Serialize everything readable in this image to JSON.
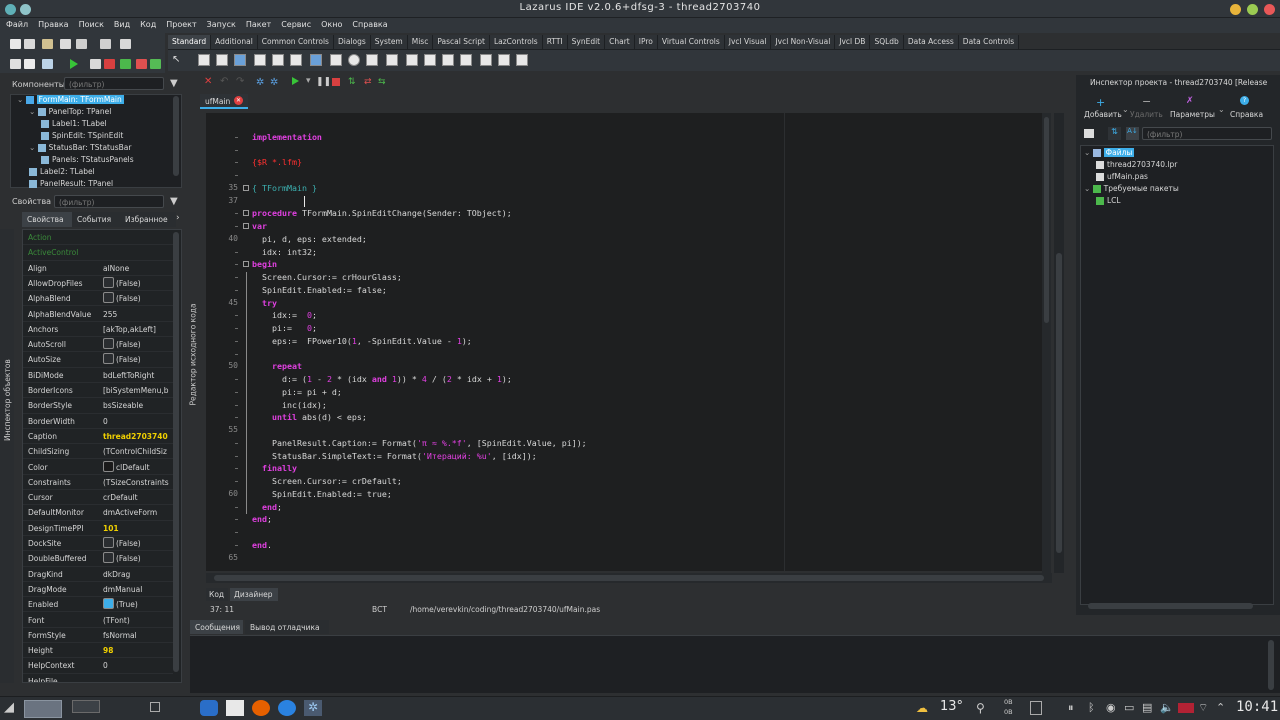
{
  "window": {
    "title": "Lazarus IDE v2.0.6+dfsg-3 - thread2703740"
  },
  "menu": [
    "Файл",
    "Правка",
    "Поиск",
    "Вид",
    "Код",
    "Проект",
    "Запуск",
    "Пакет",
    "Сервис",
    "Окно",
    "Справка"
  ],
  "palette_tabs": [
    "Standard",
    "Additional",
    "Common Controls",
    "Dialogs",
    "System",
    "Misc",
    "Pascal Script",
    "LazControls",
    "RTTI",
    "SynEdit",
    "Chart",
    "IPro",
    "Virtual Controls",
    "Jvcl Visual",
    "Jvcl Non-Visual",
    "Jvcl DB",
    "SQLdb",
    "Data Access",
    "Data Controls"
  ],
  "components": {
    "label": "Компоненты",
    "filter_placeholder": "(фильтр)",
    "tree": [
      {
        "text": "FormMain: TFormMain",
        "level": 0,
        "selected": true
      },
      {
        "text": "PanelTop: TPanel",
        "level": 1
      },
      {
        "text": "Label1: TLabel",
        "level": 2
      },
      {
        "text": "SpinEdit: TSpinEdit",
        "level": 2
      },
      {
        "text": "StatusBar: TStatusBar",
        "level": 1
      },
      {
        "text": "Panels: TStatusPanels",
        "level": 2
      },
      {
        "text": "Label2: TLabel",
        "level": 1
      },
      {
        "text": "PanelResult: TPanel",
        "level": 1
      }
    ]
  },
  "properties": {
    "label": "Свойства",
    "filter_placeholder": "(фильтр)",
    "tabs": [
      "Свойства",
      "События",
      "Избранное"
    ],
    "side_label": "Инспектор объектов",
    "rows": [
      {
        "name": "Action",
        "value": "",
        "type": "text"
      },
      {
        "name": "ActiveControl",
        "value": "",
        "type": "text"
      },
      {
        "name": "Align",
        "value": "alNone",
        "type": "text"
      },
      {
        "name": "AllowDropFiles",
        "value": "(False)",
        "type": "check"
      },
      {
        "name": "AlphaBlend",
        "value": "(False)",
        "type": "check"
      },
      {
        "name": "AlphaBlendValue",
        "value": "255",
        "type": "text"
      },
      {
        "name": "Anchors",
        "value": "[akTop,akLeft]",
        "type": "text",
        "expand": true
      },
      {
        "name": "AutoScroll",
        "value": "(False)",
        "type": "check"
      },
      {
        "name": "AutoSize",
        "value": "(False)",
        "type": "check"
      },
      {
        "name": "BiDiMode",
        "value": "bdLeftToRight",
        "type": "text"
      },
      {
        "name": "BorderIcons",
        "value": "[biSystemMenu,b",
        "type": "text",
        "expand": true
      },
      {
        "name": "BorderStyle",
        "value": "bsSizeable",
        "type": "text"
      },
      {
        "name": "BorderWidth",
        "value": "0",
        "type": "text"
      },
      {
        "name": "Caption",
        "value": "thread2703740",
        "type": "text",
        "bold": true
      },
      {
        "name": "ChildSizing",
        "value": "(TControlChildSiz",
        "type": "text",
        "expand": true
      },
      {
        "name": "Color",
        "value": "clDefault",
        "type": "color"
      },
      {
        "name": "Constraints",
        "value": "(TSizeConstraints",
        "type": "text",
        "expand": true
      },
      {
        "name": "Cursor",
        "value": "crDefault",
        "type": "text"
      },
      {
        "name": "DefaultMonitor",
        "value": "dmActiveForm",
        "type": "text"
      },
      {
        "name": "DesignTimePPI",
        "value": "101",
        "type": "text",
        "bold": true
      },
      {
        "name": "DockSite",
        "value": "(False)",
        "type": "check"
      },
      {
        "name": "DoubleBuffered",
        "value": "(False)",
        "type": "check"
      },
      {
        "name": "DragKind",
        "value": "dkDrag",
        "type": "text"
      },
      {
        "name": "DragMode",
        "value": "dmManual",
        "type": "text"
      },
      {
        "name": "Enabled",
        "value": "(True)",
        "type": "checked"
      },
      {
        "name": "Font",
        "value": "(TFont)",
        "type": "text",
        "expand": true
      },
      {
        "name": "FormStyle",
        "value": "fsNormal",
        "type": "text"
      },
      {
        "name": "Height",
        "value": "98",
        "type": "text",
        "bold": true
      },
      {
        "name": "HelpContext",
        "value": "0",
        "type": "text"
      },
      {
        "name": "HelpFile",
        "value": "",
        "type": "text"
      }
    ]
  },
  "editor": {
    "tab": "ufMain",
    "side_label": "Редактор исходного кода",
    "bottom_tabs": [
      "Код",
      "Дизайнер"
    ],
    "status": {
      "pos": "37:  11",
      "mode": "ВСТ",
      "file": "/home/verevkin/coding/thread2703740/ufMain.pas"
    },
    "line_numbers": [
      {
        "n": "35",
        "row": 4
      },
      {
        "n": "37",
        "row": 5
      },
      {
        "n": "40",
        "row": 8
      },
      {
        "n": "45",
        "row": 13
      },
      {
        "n": "50",
        "row": 18
      },
      {
        "n": "55",
        "row": 23
      },
      {
        "n": "60",
        "row": 28
      },
      {
        "n": "65",
        "row": 33
      }
    ]
  },
  "messages": {
    "tabs": [
      "Сообщения",
      "Вывод отладчика"
    ]
  },
  "project_inspector": {
    "title": "Инспектор проекта - thread2703740 [Release",
    "buttons": [
      "Добавить",
      "Удалить",
      "Параметры",
      "Справка"
    ],
    "filter_placeholder": "(фильтр)",
    "tree": [
      {
        "text": "Файлы",
        "level": 0,
        "selected": true
      },
      {
        "text": "thread2703740.lpr",
        "level": 1
      },
      {
        "text": "ufMain.pas",
        "level": 1
      },
      {
        "text": "Требуемые пакеты",
        "level": 0
      },
      {
        "text": "LCL",
        "level": 1
      }
    ]
  },
  "taskbar": {
    "temperature": "13°",
    "time": "10:41",
    "net_up": "0B",
    "net_down": "0B"
  }
}
